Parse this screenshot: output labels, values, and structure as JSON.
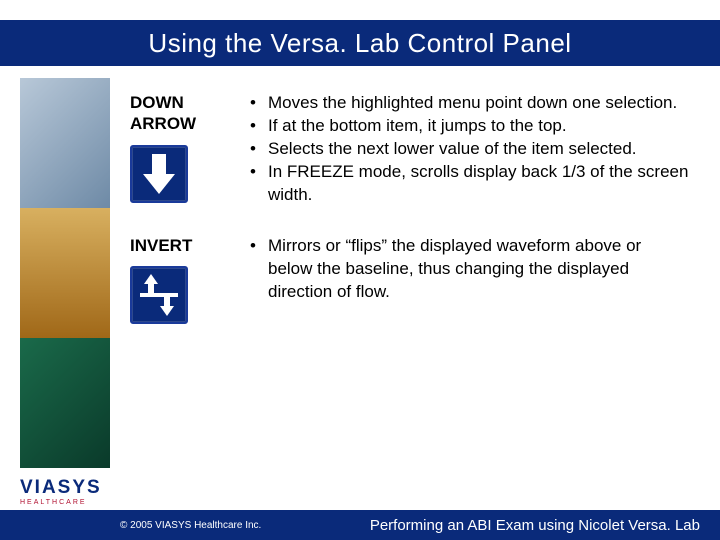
{
  "title": "Using the Versa. Lab Control Panel",
  "sections": [
    {
      "label": "DOWN ARROW",
      "bullets": [
        "Moves the highlighted menu point down one selection.",
        "If at the bottom item, it jumps to the top.",
        "Selects the next lower value of the item selected.",
        "In FREEZE mode, scrolls display back 1/3 of the screen width."
      ]
    },
    {
      "label": "INVERT",
      "bullets": [
        "Mirrors or “flips” the displayed waveform above or below the baseline, thus changing the displayed direction of flow."
      ]
    }
  ],
  "logo": {
    "brand": "VIASYS",
    "sub": "HEALTHCARE"
  },
  "copyright": "© 2005 VIASYS Healthcare Inc.",
  "footer_title": "Performing an ABI Exam using Nicolet Versa. Lab"
}
